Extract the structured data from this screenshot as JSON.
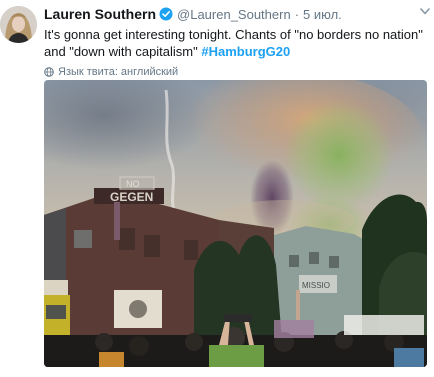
{
  "tweet": {
    "fullname": "Lauren Southern",
    "username": "@Lauren_Southern",
    "separator": "·",
    "time": "5 июл.",
    "text_main": "It's gonna get interesting tonight. Chants of \"no borders no nation\" and \"down with capitalism\"",
    "hashtag": "#HamburgG20",
    "language_label": "Язык твита: английский"
  },
  "icons": {
    "verified": "verified-badge-icon",
    "more": "chevron-down-icon",
    "language": "globe-icon"
  },
  "colors": {
    "accent": "#1da1f2",
    "secondary_text": "#657786",
    "primary_text": "#14171a"
  }
}
